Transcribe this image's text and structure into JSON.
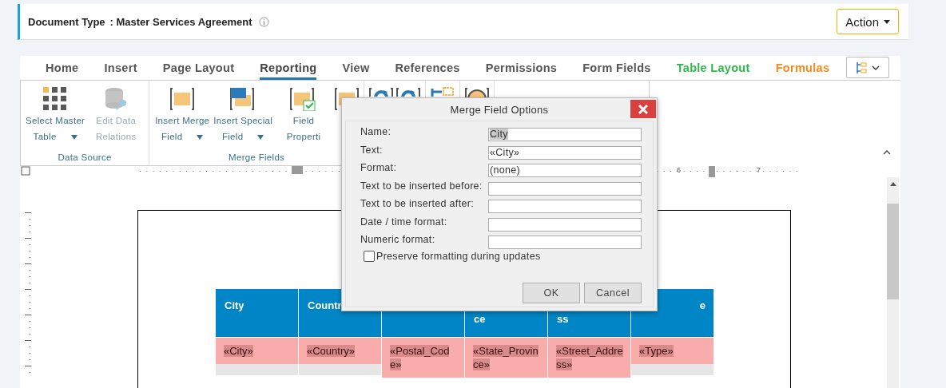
{
  "document_header": {
    "label": "Document Type",
    "value": ": Master Services Agreement",
    "action_button": "Action"
  },
  "tabs": [
    {
      "label": "Home",
      "selected": false,
      "color": "#555555"
    },
    {
      "label": "Insert",
      "selected": false,
      "color": "#555555"
    },
    {
      "label": "Page Layout",
      "selected": false,
      "color": "#555555"
    },
    {
      "label": "Reporting",
      "selected": true,
      "color": "#444444"
    },
    {
      "label": "View",
      "selected": false,
      "color": "#555555"
    },
    {
      "label": "References",
      "selected": false,
      "color": "#555555"
    },
    {
      "label": "Permissions",
      "selected": false,
      "color": "#555555"
    },
    {
      "label": "Form Fields",
      "selected": false,
      "color": "#555555"
    },
    {
      "label": "Table Layout",
      "selected": false,
      "color": "#2eb84b"
    },
    {
      "label": "Formulas",
      "selected": false,
      "color": "#f58a1f"
    }
  ],
  "ribbon_groups": [
    {
      "name": "Data Source",
      "items": [
        {
          "kind": "grid",
          "lines": [
            "Select Master",
            "Table"
          ],
          "dropdown": true,
          "disabled": false
        },
        {
          "kind": "database",
          "lines": [
            "Edit Data",
            "Relations"
          ],
          "disabled": true
        }
      ]
    },
    {
      "name": "Merge Fields",
      "items": [
        {
          "kind": "merge",
          "lines": [
            "Insert Merge",
            "Field"
          ],
          "dropdown": true
        },
        {
          "kind": "special",
          "lines": [
            "Insert Special",
            "Field"
          ],
          "dropdown": true
        },
        {
          "kind": "properties",
          "lines": [
            "Field",
            "Properti"
          ]
        },
        {
          "kind": "merge"
        }
      ]
    },
    {
      "items": [
        {
          "kind": "refresh"
        },
        {
          "kind": "refresh"
        }
      ]
    },
    {
      "items": [
        {
          "kind": "layout"
        }
      ]
    },
    {
      "items": [
        {
          "kind": "badge"
        }
      ]
    }
  ],
  "ruler_labels": [
    "6",
    "7"
  ],
  "table": {
    "columns": [
      {
        "header": {
          "text": "City",
          "wrapped": false
        },
        "cell": "«City»"
      },
      {
        "header": {
          "text": "Countr",
          "wrapped": false
        },
        "cell": "«Country»"
      },
      {
        "cell": "«Postal_Code»"
      },
      {
        "header": {
          "text": "ce",
          "wrapped": true
        },
        "cell": "«State_Province»"
      },
      {
        "header": {
          "text": "ss",
          "wrapped": true
        },
        "cell": "«Street_Address»"
      },
      {
        "header": {
          "text": "e",
          "wrapped": false
        },
        "cell": "«Type»"
      }
    ]
  },
  "dialog": {
    "title": "Merge Field Options",
    "fields": [
      {
        "label": "Name:",
        "value": "City",
        "selected": true
      },
      {
        "label": "Text:",
        "value": "«City»",
        "selected": false
      },
      {
        "label": "Format:",
        "value": "(none)",
        "selected": false
      },
      {
        "label": "Text to be inserted before:"
      },
      {
        "label": "Text to be inserted after:"
      },
      {
        "label": "Date / time format:"
      },
      {
        "label": "Numeric format:"
      }
    ],
    "checkbox": {
      "label": "Preserve formatting during updates",
      "checked": false
    },
    "buttons": [
      "OK",
      "Cancel"
    ]
  }
}
